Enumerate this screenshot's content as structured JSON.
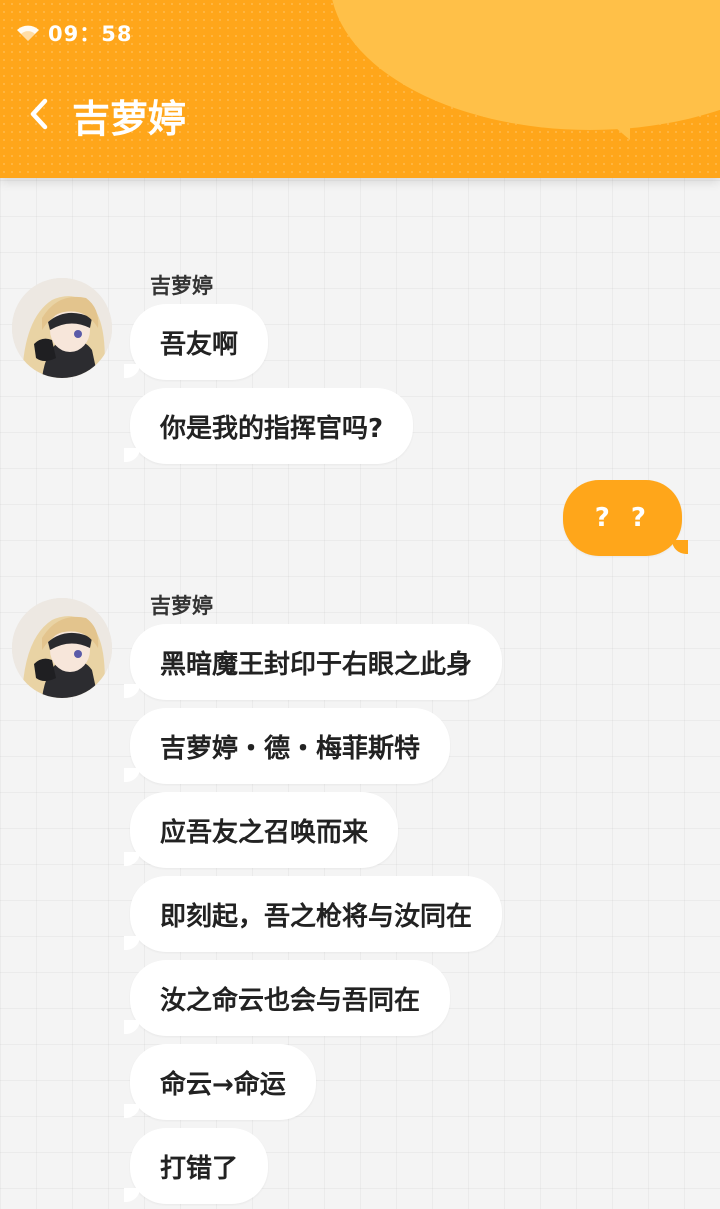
{
  "status_bar": {
    "time": "09：58",
    "wifi_icon": "wifi-icon"
  },
  "header": {
    "title": "吉萝婷",
    "back_icon": "chevron-left-icon",
    "background": "#ffa61a"
  },
  "messages": [
    {
      "from": "other",
      "sender": "吉萝婷",
      "text": "吾友啊"
    },
    {
      "from": "other",
      "text": "你是我的指挥官吗?"
    },
    {
      "from": "me",
      "text": "? ?"
    },
    {
      "from": "other",
      "sender": "吉萝婷",
      "text": "黑暗魔王封印于右眼之此身"
    },
    {
      "from": "other",
      "text": "吉萝婷・德・梅菲斯特"
    },
    {
      "from": "other",
      "text": "应吾友之召唤而来"
    },
    {
      "from": "other",
      "text": "即刻起，吾之枪将与汝同在"
    },
    {
      "from": "other",
      "text": "汝之命云也会与吾同在"
    },
    {
      "from": "other",
      "text": "命云→命运"
    },
    {
      "from": "other",
      "text": "打错了"
    }
  ]
}
